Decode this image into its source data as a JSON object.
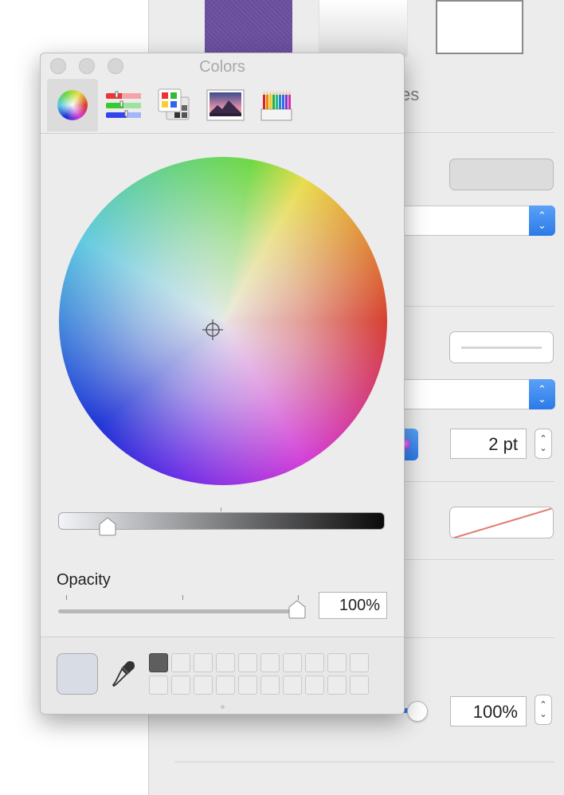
{
  "window": {
    "title": "Colors"
  },
  "inspector": {
    "tab_text": "es",
    "stroke_width": "2 pt",
    "opacity_value": "100%",
    "stepper_up": "⌃",
    "stepper_down": "⌄"
  },
  "colors_panel": {
    "modes": [
      {
        "name": "color-wheel",
        "active": true
      },
      {
        "name": "color-sliders",
        "active": false
      },
      {
        "name": "color-palettes",
        "active": false
      },
      {
        "name": "image-palettes",
        "active": false
      },
      {
        "name": "pencils",
        "active": false
      }
    ],
    "brightness_fraction": 0.15,
    "opacity_label": "Opacity",
    "opacity_value": "100%",
    "opacity_fraction": 1.0,
    "current_color": "#d8dce5",
    "swatches": {
      "rows": 2,
      "cols": 10,
      "filled": [
        "#5e5e5e"
      ]
    }
  }
}
